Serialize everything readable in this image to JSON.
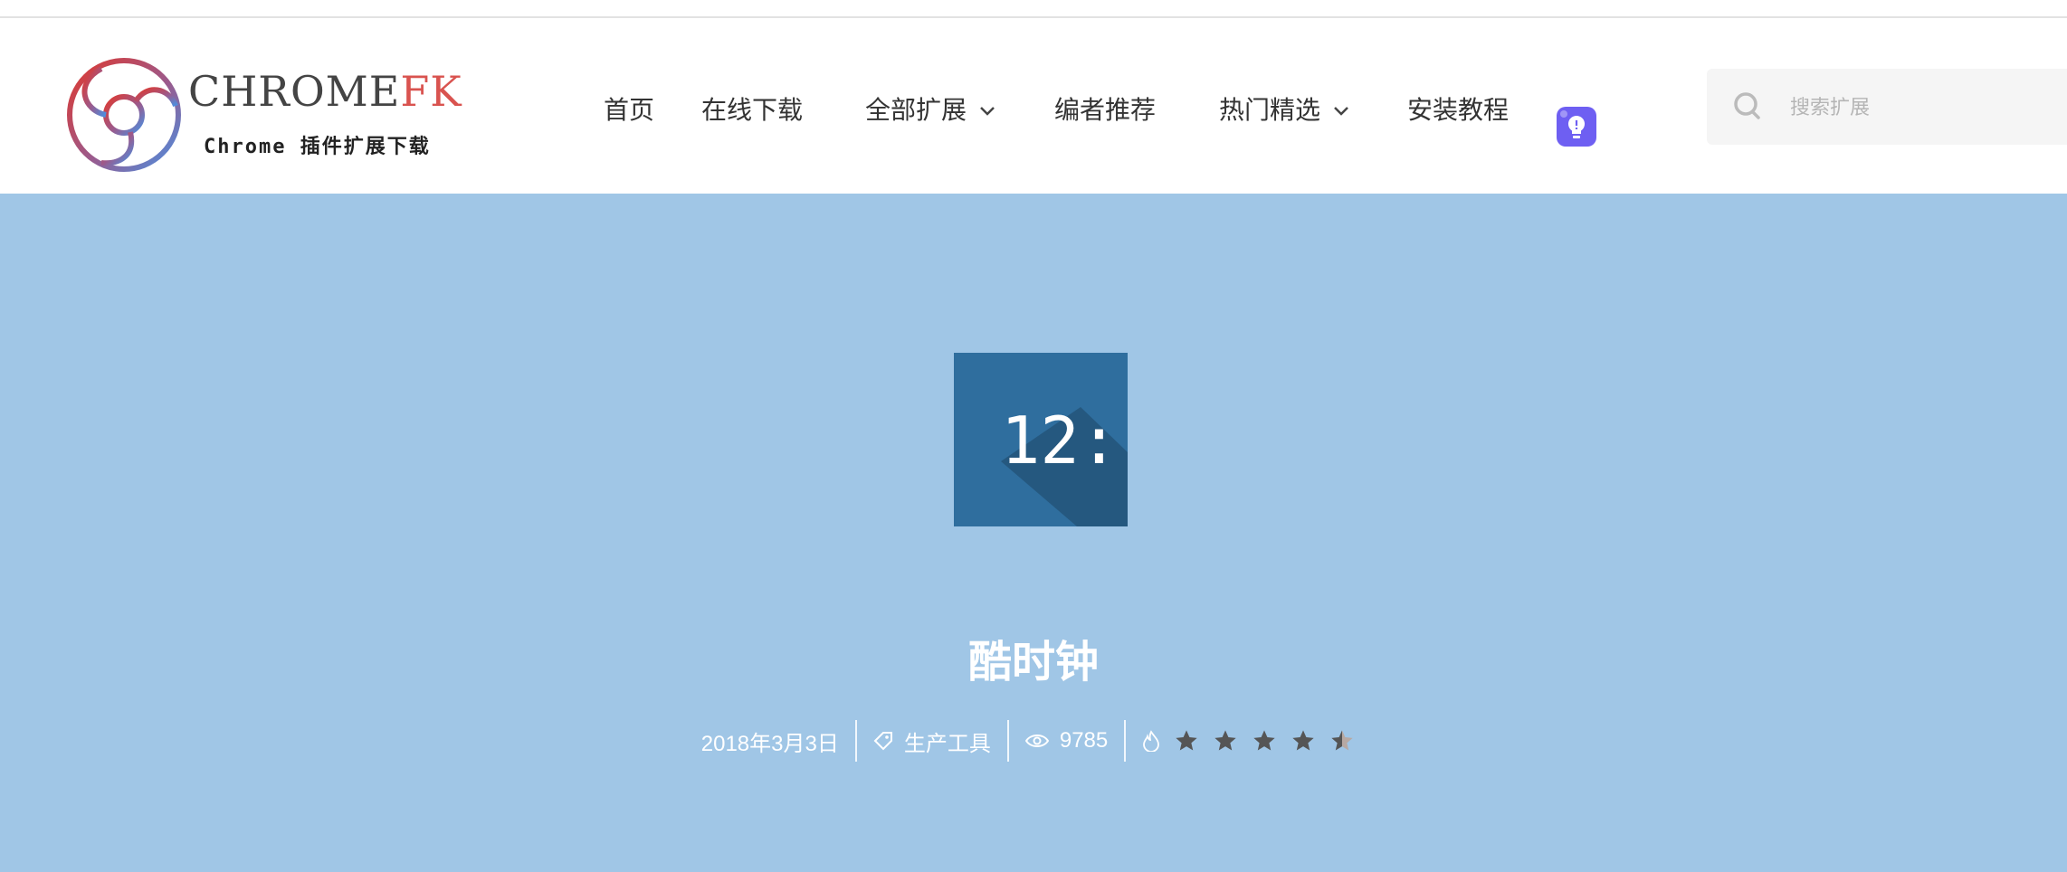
{
  "site": {
    "logo_main": "CHROME",
    "logo_accent": "FK",
    "logo_sub": "Chrome 插件扩展下载"
  },
  "nav": {
    "items": [
      {
        "label": "首页"
      },
      {
        "label": "在线下载"
      },
      {
        "label": "全部扩展",
        "dropdown": true
      },
      {
        "label": "编者推荐"
      },
      {
        "label": "热门精选",
        "dropdown": true
      },
      {
        "label": "安装教程"
      }
    ],
    "idea_icon": "lightbulb-icon"
  },
  "search": {
    "placeholder": "搜索扩展"
  },
  "app": {
    "icon_text": "12:",
    "title": "酷时钟",
    "date": "2018年3月3日",
    "category": "生产工具",
    "views": "9785",
    "rating": 4.5
  },
  "colors": {
    "hero_bg": "#a0c6e6",
    "icon_bg": "#2f6e9e",
    "accent_red": "#d9534f",
    "idea_btn": "#6e5ff2"
  }
}
